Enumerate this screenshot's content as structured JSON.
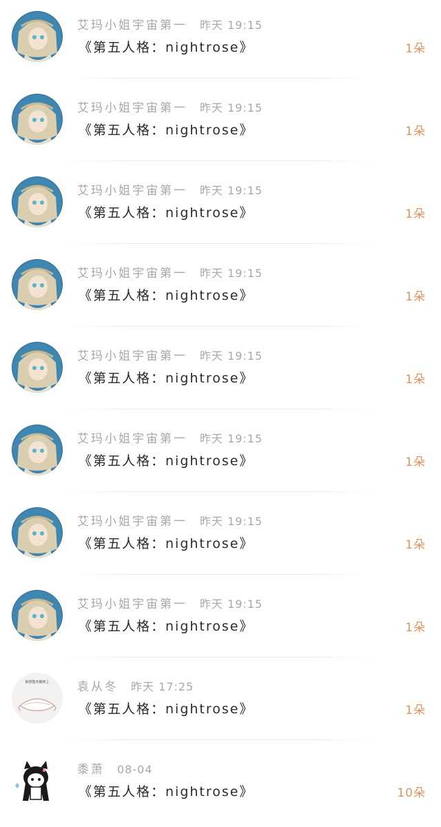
{
  "messages": [
    {
      "sender": "艾玛小姐宇宙第一",
      "time": "昨天 19:15",
      "text": "《第五人格：nightrose》",
      "count": "1朵",
      "avatar": "anime-girl-avatar"
    },
    {
      "sender": "艾玛小姐宇宙第一",
      "time": "昨天 19:15",
      "text": "《第五人格：nightrose》",
      "count": "1朵",
      "avatar": "anime-girl-avatar"
    },
    {
      "sender": "艾玛小姐宇宙第一",
      "time": "昨天 19:15",
      "text": "《第五人格：nightrose》",
      "count": "1朵",
      "avatar": "anime-girl-avatar"
    },
    {
      "sender": "艾玛小姐宇宙第一",
      "time": "昨天 19:15",
      "text": "《第五人格：nightrose》",
      "count": "1朵",
      "avatar": "anime-girl-avatar"
    },
    {
      "sender": "艾玛小姐宇宙第一",
      "time": "昨天 19:15",
      "text": "《第五人格：nightrose》",
      "count": "1朵",
      "avatar": "anime-girl-avatar"
    },
    {
      "sender": "艾玛小姐宇宙第一",
      "time": "昨天 19:15",
      "text": "《第五人格：nightrose》",
      "count": "1朵",
      "avatar": "anime-girl-avatar"
    },
    {
      "sender": "艾玛小姐宇宙第一",
      "time": "昨天 19:15",
      "text": "《第五人格：nightrose》",
      "count": "1朵",
      "avatar": "anime-girl-avatar"
    },
    {
      "sender": "艾玛小姐宇宙第一",
      "time": "昨天 19:15",
      "text": "《第五人格：nightrose》",
      "count": "1朵",
      "avatar": "anime-girl-avatar"
    },
    {
      "sender": "袁从冬",
      "time": "昨天 17:25",
      "text": "《第五人格：nightrose》",
      "count": "1朵",
      "avatar": "meme-sticker-avatar",
      "avatar_caption": "就想整天躺床上"
    },
    {
      "sender": "黍萧",
      "time": "08-04",
      "text": "《第五人格：nightrose》",
      "count": "10朵",
      "avatar": "chibi-cat-girl-avatar"
    }
  ],
  "colors": {
    "accent": "#e0935c",
    "meta_text": "#a8a8a8",
    "body_text": "#2a2a2a"
  }
}
